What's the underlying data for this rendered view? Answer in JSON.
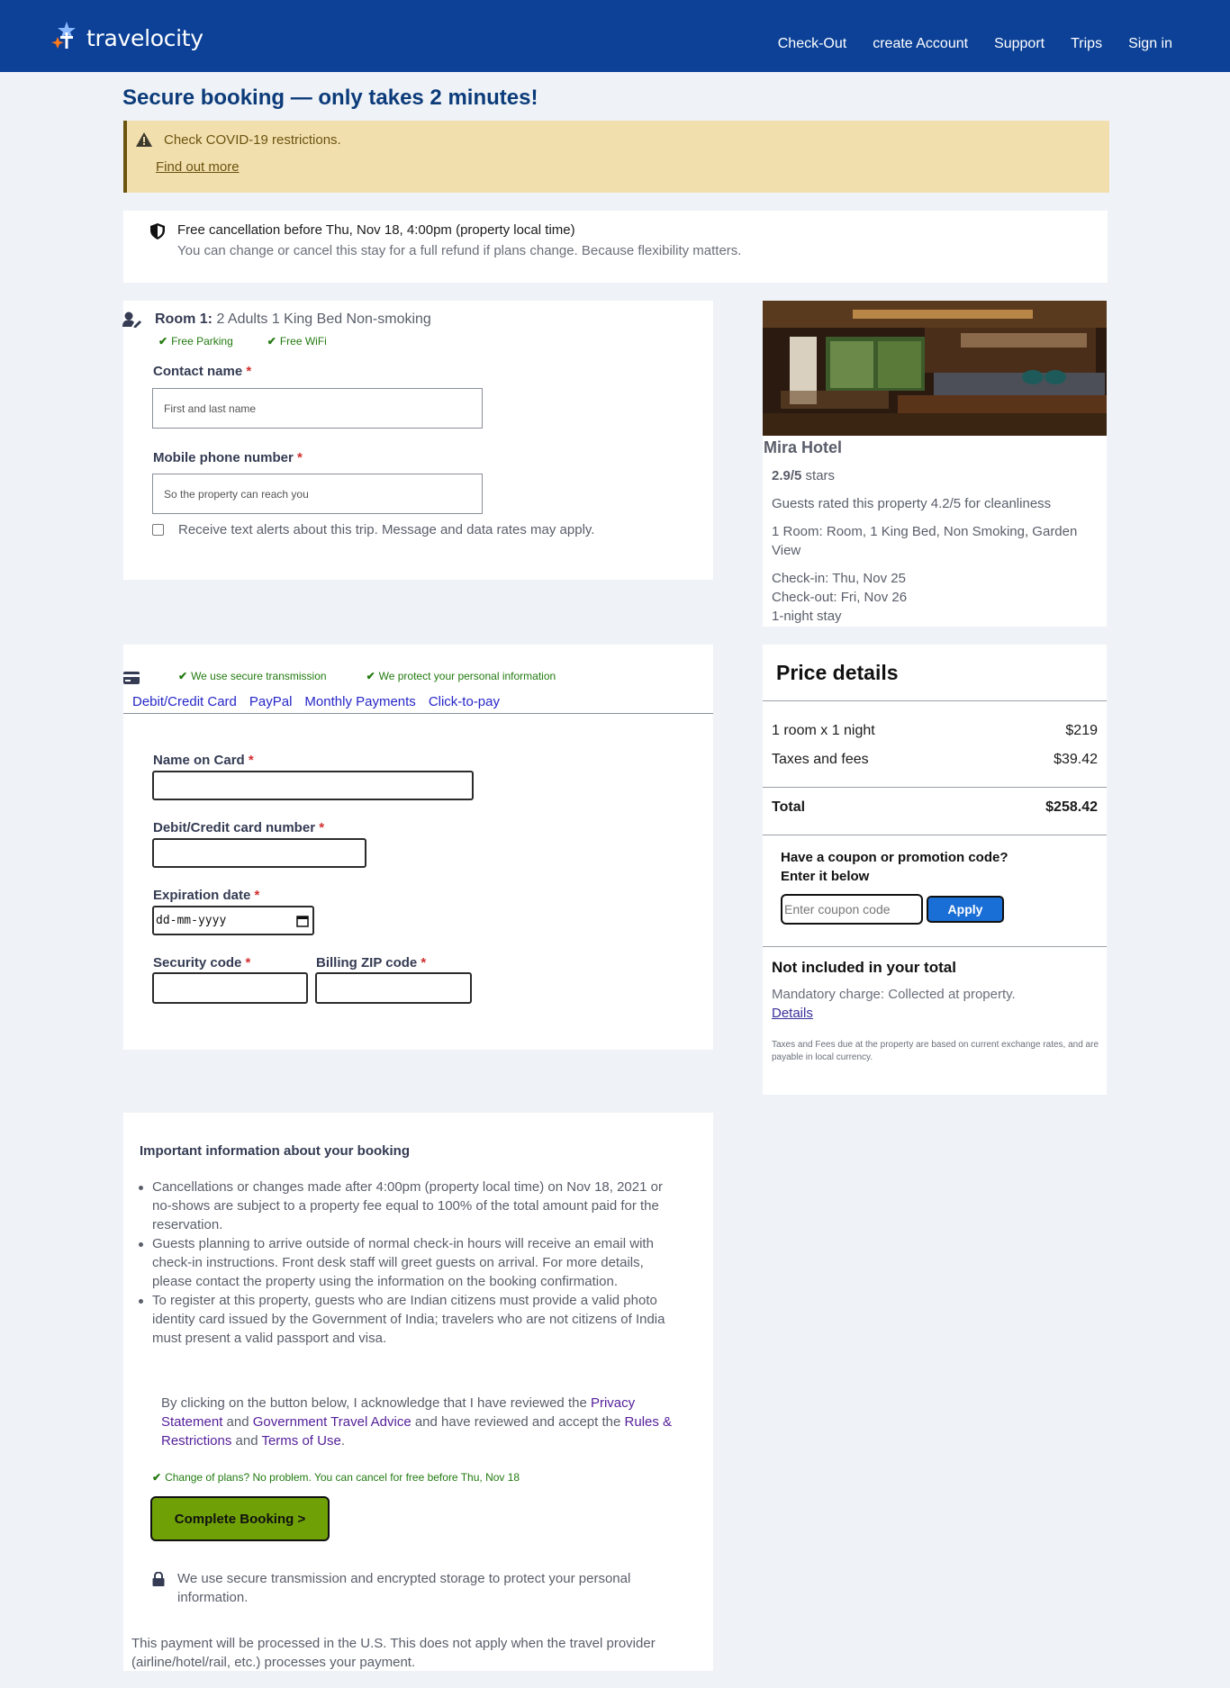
{
  "brand": {
    "name": "travelocity",
    "colors": {
      "header": "#0c4197",
      "accent": "#1a6fd6",
      "success": "#227a10",
      "book": "#6fa106"
    }
  },
  "nav": [
    "Check-Out",
    "create Account",
    "Support",
    "Trips",
    "Sign in"
  ],
  "page_title": "Secure booking — only takes 2 minutes!",
  "covid": {
    "message": "Check COVID-19 restrictions.",
    "link": "Find out more",
    "icon": "warning-icon"
  },
  "cancellation": {
    "title": "Free cancellation before Thu, Nov 18, 4:00pm (property local time)",
    "subtitle": "You can change or cancel this stay for a full refund if plans change. Because flexibility matters."
  },
  "room": {
    "label": "Room 1:",
    "desc": "2 Adults 1 King Bed Non-smoking",
    "amenities": [
      "Free Parking",
      "Free WiFi"
    ],
    "contact_label": "Contact name",
    "contact_placeholder": "First and last name",
    "phone_label": "Mobile phone number",
    "phone_placeholder": "So the property can reach you",
    "sms_text": "Receive text alerts about this trip. Message and data rates may apply.",
    "required_mark": "*"
  },
  "hotel": {
    "name": "Mira Hotel",
    "rating": "2.9/5",
    "rating_suffix": "stars",
    "cleanliness": "Guests rated this property 4.2/5 for cleanliness",
    "room": "1 Room: Room, 1 King Bed, Non Smoking, Garden View",
    "checkin": "Check-in: Thu, Nov 25",
    "checkout": "Check-out: Fri, Nov 26",
    "stay": "1-night stay"
  },
  "payment": {
    "secure": [
      "We use secure transmission",
      "We protect your personal information"
    ],
    "tabs": [
      "Debit/Credit Card",
      "PayPal",
      "Monthly Payments",
      "Click-to-pay"
    ],
    "name_label": "Name on Card",
    "number_label": "Debit/Credit card number",
    "expiry_label": "Expiration date",
    "expiry_placeholder": "dd-mm-yyyy",
    "cvv_label": "Security code",
    "zip_label": "Billing ZIP code"
  },
  "price": {
    "title": "Price details",
    "rows": [
      {
        "label": "1 room x 1 night",
        "value": "$219"
      },
      {
        "label": "Taxes and fees",
        "value": "$39.42"
      }
    ],
    "total_label": "Total",
    "total_value": "$258.42",
    "coupon_heading_1": "Have a coupon or promotion code?",
    "coupon_heading_2": "Enter it below",
    "coupon_placeholder": "Enter coupon code",
    "apply": "Apply",
    "not_included": "Not included in your total",
    "mandatory": "Mandatory charge: Collected at property.",
    "details": "Details",
    "fine": "Taxes and Fees due at the property are based on current exchange rates, and are payable in local currency."
  },
  "info": {
    "title": "Important information about your booking",
    "items": [
      "Cancellations or changes made after 4:00pm (property local time) on Nov 18, 2021 or no-shows are subject to a property fee equal to 100% of the total amount paid for the reservation.",
      "Guests planning to arrive outside of normal check-in hours will receive an email with check-in instructions. Front desk staff will greet guests on arrival. For more details, please contact the property using the information on the booking confirmation.",
      "To register at this property, guests who are Indian citizens must provide a valid photo identity card issued by the Government of India; travelers who are not citizens of India must present a valid passport and visa."
    ],
    "ack_1": "By clicking on the button below, I acknowledge that I have reviewed the ",
    "privacy": "Privacy Statement",
    "ack_2": " and ",
    "gov": "Government Travel Advice",
    "ack_3": " and have reviewed and accept the ",
    "rules": "Rules & Restrictions",
    "ack_4": " and ",
    "terms": "Terms of Use",
    "ack_5": ".",
    "change": "Change of plans? No problem. You can cancel for free before Thu, Nov 18",
    "book_button": "Complete Booking >",
    "secure_text": "We use secure transmission and encrypted storage to protect your personal information.",
    "processed": "This payment will be processed in the U.S. This does not apply when the travel provider (airline/hotel/rail, etc.) processes your payment."
  }
}
